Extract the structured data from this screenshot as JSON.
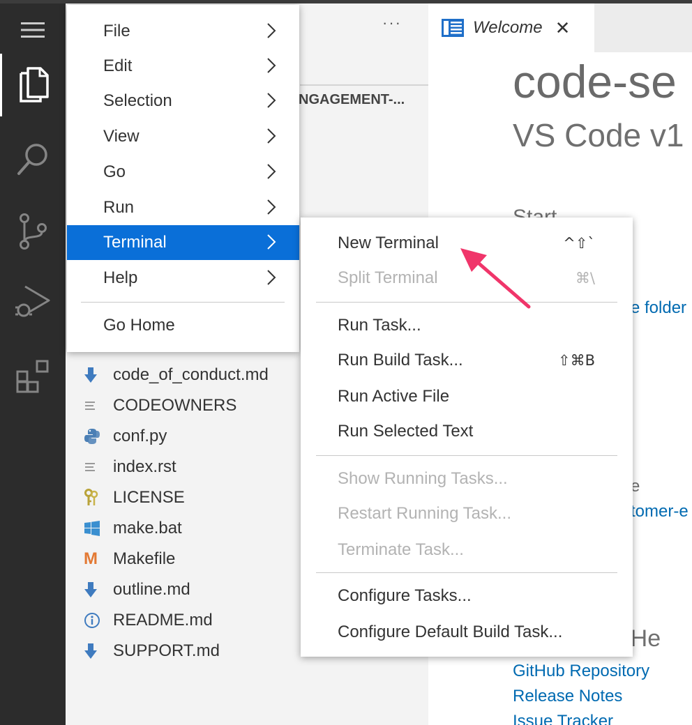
{
  "sidebar": {
    "more_actions": "···",
    "section_title": "NGAGEMENT-...",
    "files": [
      {
        "name": "code_of_conduct.md",
        "icon": "download-arrow-icon"
      },
      {
        "name": "CODEOWNERS",
        "icon": "text-lines-icon"
      },
      {
        "name": "conf.py",
        "icon": "python-icon"
      },
      {
        "name": "index.rst",
        "icon": "text-lines-icon"
      },
      {
        "name": "LICENSE",
        "icon": "keys-icon"
      },
      {
        "name": "make.bat",
        "icon": "windows-icon"
      },
      {
        "name": "Makefile",
        "icon": "makefile-m-icon",
        "glyph": "M"
      },
      {
        "name": "outline.md",
        "icon": "download-arrow-icon"
      },
      {
        "name": "README.md",
        "icon": "info-icon",
        "glyph": "i"
      },
      {
        "name": "SUPPORT.md",
        "icon": "download-arrow-icon"
      }
    ]
  },
  "editor": {
    "tab_label": "Welcome",
    "tab_close": "✕",
    "title": "code-se",
    "subtitle": "VS Code v1",
    "start_heading": "Start",
    "open_folder_fragment": "e folder",
    "recent_fragment_label": "e",
    "recent_fragment_link": "tomer-e",
    "help_heading": "er He",
    "help_links": [
      "GitHub Repository",
      "Release Notes",
      "Issue Tracker"
    ]
  },
  "main_menu": {
    "items": [
      {
        "label": "File",
        "chevron": "❯"
      },
      {
        "label": "Edit",
        "chevron": "❯"
      },
      {
        "label": "Selection",
        "chevron": "❯"
      },
      {
        "label": "View",
        "chevron": "❯"
      },
      {
        "label": "Go",
        "chevron": "❯"
      },
      {
        "label": "Run",
        "chevron": "❯"
      },
      {
        "label": "Terminal",
        "chevron": "❯",
        "selected": true
      },
      {
        "label": "Help",
        "chevron": "❯"
      }
    ],
    "go_home": "Go Home"
  },
  "terminal_menu": {
    "items": [
      {
        "label": "New Terminal",
        "shortcut": "^⇧`",
        "enabled": true
      },
      {
        "label": "Split Terminal",
        "shortcut": "⌘\\",
        "enabled": false
      },
      {
        "label": "Run Task...",
        "shortcut": "",
        "enabled": true
      },
      {
        "label": "Run Build Task...",
        "shortcut": "⇧⌘B",
        "enabled": true
      },
      {
        "label": "Run Active File",
        "shortcut": "",
        "enabled": true
      },
      {
        "label": "Run Selected Text",
        "shortcut": "",
        "enabled": true
      },
      {
        "label": "Show Running Tasks...",
        "shortcut": "",
        "enabled": false
      },
      {
        "label": "Restart Running Task...",
        "shortcut": "",
        "enabled": false
      },
      {
        "label": "Terminate Task...",
        "shortcut": "",
        "enabled": false
      },
      {
        "label": "Configure Tasks...",
        "shortcut": "",
        "enabled": true
      },
      {
        "label": "Configure Default Build Task...",
        "shortcut": "",
        "enabled": true
      }
    ]
  },
  "colors": {
    "activity_bar": "#2c2c2c",
    "menu_selection": "#0a6fd8",
    "link": "#006ab1",
    "annotation_arrow": "#f0356a"
  }
}
